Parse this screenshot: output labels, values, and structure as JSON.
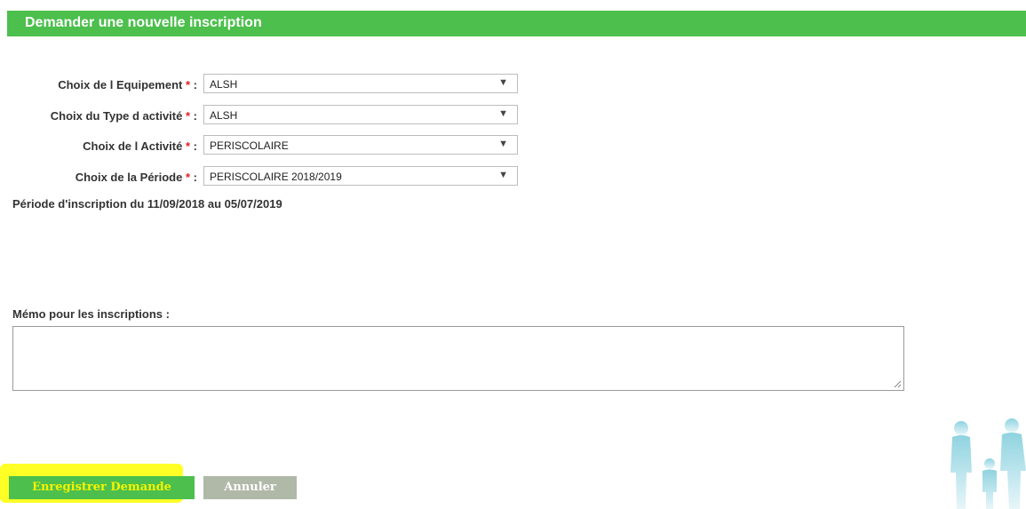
{
  "header": {
    "title": "Demander une nouvelle inscription"
  },
  "form": {
    "required_mark": "*",
    "colon": ":",
    "fields": [
      {
        "label": "Choix de l Equipement",
        "value": "ALSH"
      },
      {
        "label": "Choix du Type d activité",
        "value": "ALSH"
      },
      {
        "label": "Choix de l Activité",
        "value": "PERISCOLAIRE"
      },
      {
        "label": "Choix de la Période",
        "value": "PERISCOLAIRE 2018/2019"
      }
    ],
    "period_info": "Période d'inscription du 11/09/2018 au 05/07/2019",
    "memo_label": "Mémo pour les inscriptions :",
    "memo_value": ""
  },
  "actions": {
    "save_label": "Enregistrer Demande",
    "cancel_label": "Annuler"
  },
  "colors": {
    "accent_green": "#4cbf4c",
    "required_red": "#e02020",
    "cancel_gray": "#b0b8a8",
    "highlight_yellow": "#ffff00"
  },
  "icons": {
    "dropdown": "triangle-down-icon",
    "decoration": "family-silhouette-icon"
  }
}
